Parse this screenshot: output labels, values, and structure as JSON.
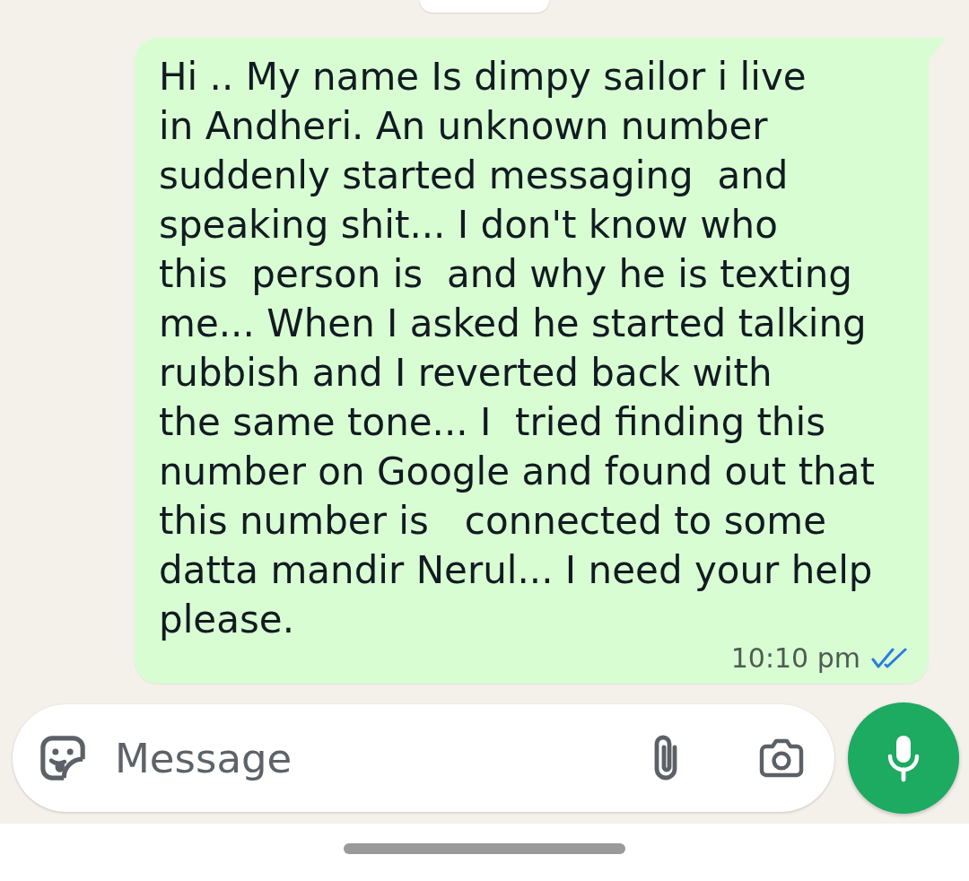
{
  "chat": {
    "messages": [
      {
        "kind": "outgoing",
        "text": "Hi .. My name Is dimpy sailor i live\nin Andheri. An unknown number\nsuddenly started messaging  and\nspeaking shit... I don't know who\nthis  person is  and why he is texting\nme... When I asked he started talking\nrubbish and I reverted back with\nthe same tone... I  tried finding this\nnumber on Google and found out that\nthis number is   connected to some\ndatta mandir Nerul... I need your help\nplease.",
        "time": "10:10 pm",
        "read": true
      }
    ]
  },
  "composer": {
    "placeholder": "Message"
  }
}
